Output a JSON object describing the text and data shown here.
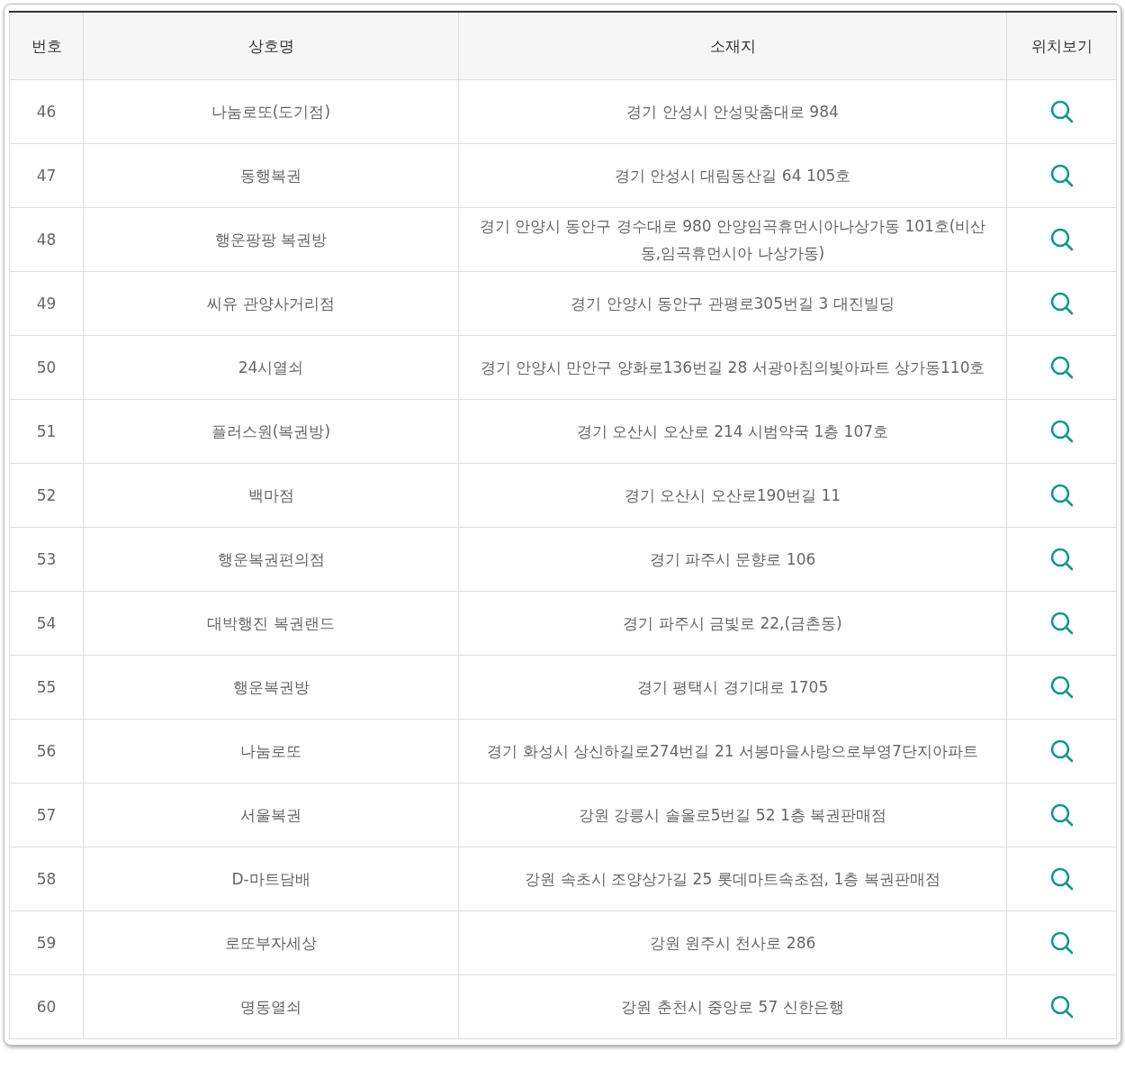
{
  "table": {
    "columns": [
      "번호",
      "상호명",
      "소재지",
      "위치보기"
    ],
    "rows": [
      {
        "number": "46",
        "name": "나눔로또(도기점)",
        "address": "경기 안성시 안성맞춤대로 984"
      },
      {
        "number": "47",
        "name": "동행복권",
        "address": "경기 안성시 대림동산길 64 105호"
      },
      {
        "number": "48",
        "name": "행운팡팡 복권방",
        "address": "경기 안양시 동안구 경수대로 980 안양임곡휴먼시아나상가동 101호(비산동,임곡휴먼시아 나상가동)"
      },
      {
        "number": "49",
        "name": "씨유 관양사거리점",
        "address": "경기 안양시 동안구 관평로305번길 3 대진빌딩"
      },
      {
        "number": "50",
        "name": "24시열쇠",
        "address": "경기 안양시 만안구 양화로136번길 28 서광아침의빛아파트 상가동110호"
      },
      {
        "number": "51",
        "name": "플러스원(복권방)",
        "address": "경기 오산시 오산로 214 시범약국 1층 107호"
      },
      {
        "number": "52",
        "name": "백마점",
        "address": "경기 오산시 오산로190번길 11"
      },
      {
        "number": "53",
        "name": "행운복권편의점",
        "address": "경기 파주시 문향로 106"
      },
      {
        "number": "54",
        "name": "대박행진 복권랜드",
        "address": "경기 파주시 금빛로 22,(금촌동)"
      },
      {
        "number": "55",
        "name": "행운복권방",
        "address": "경기 평택시 경기대로 1705"
      },
      {
        "number": "56",
        "name": "나눔로또",
        "address": "경기 화성시 상신하길로274번길 21 서봉마을사랑으로부영7단지아파트"
      },
      {
        "number": "57",
        "name": "서울복권",
        "address": "강원 강릉시 솔올로5번길 52 1층 복권판매점"
      },
      {
        "number": "58",
        "name": "D-마트담배",
        "address": "강원 속초시 조양상가길 25 롯데마트속초점, 1층 복권판매점"
      },
      {
        "number": "59",
        "name": "로또부자세상",
        "address": "강원 원주시 천사로 286"
      },
      {
        "number": "60",
        "name": "명동열쇠",
        "address": "강원 춘천시 중앙로 57 신한은행"
      }
    ]
  }
}
